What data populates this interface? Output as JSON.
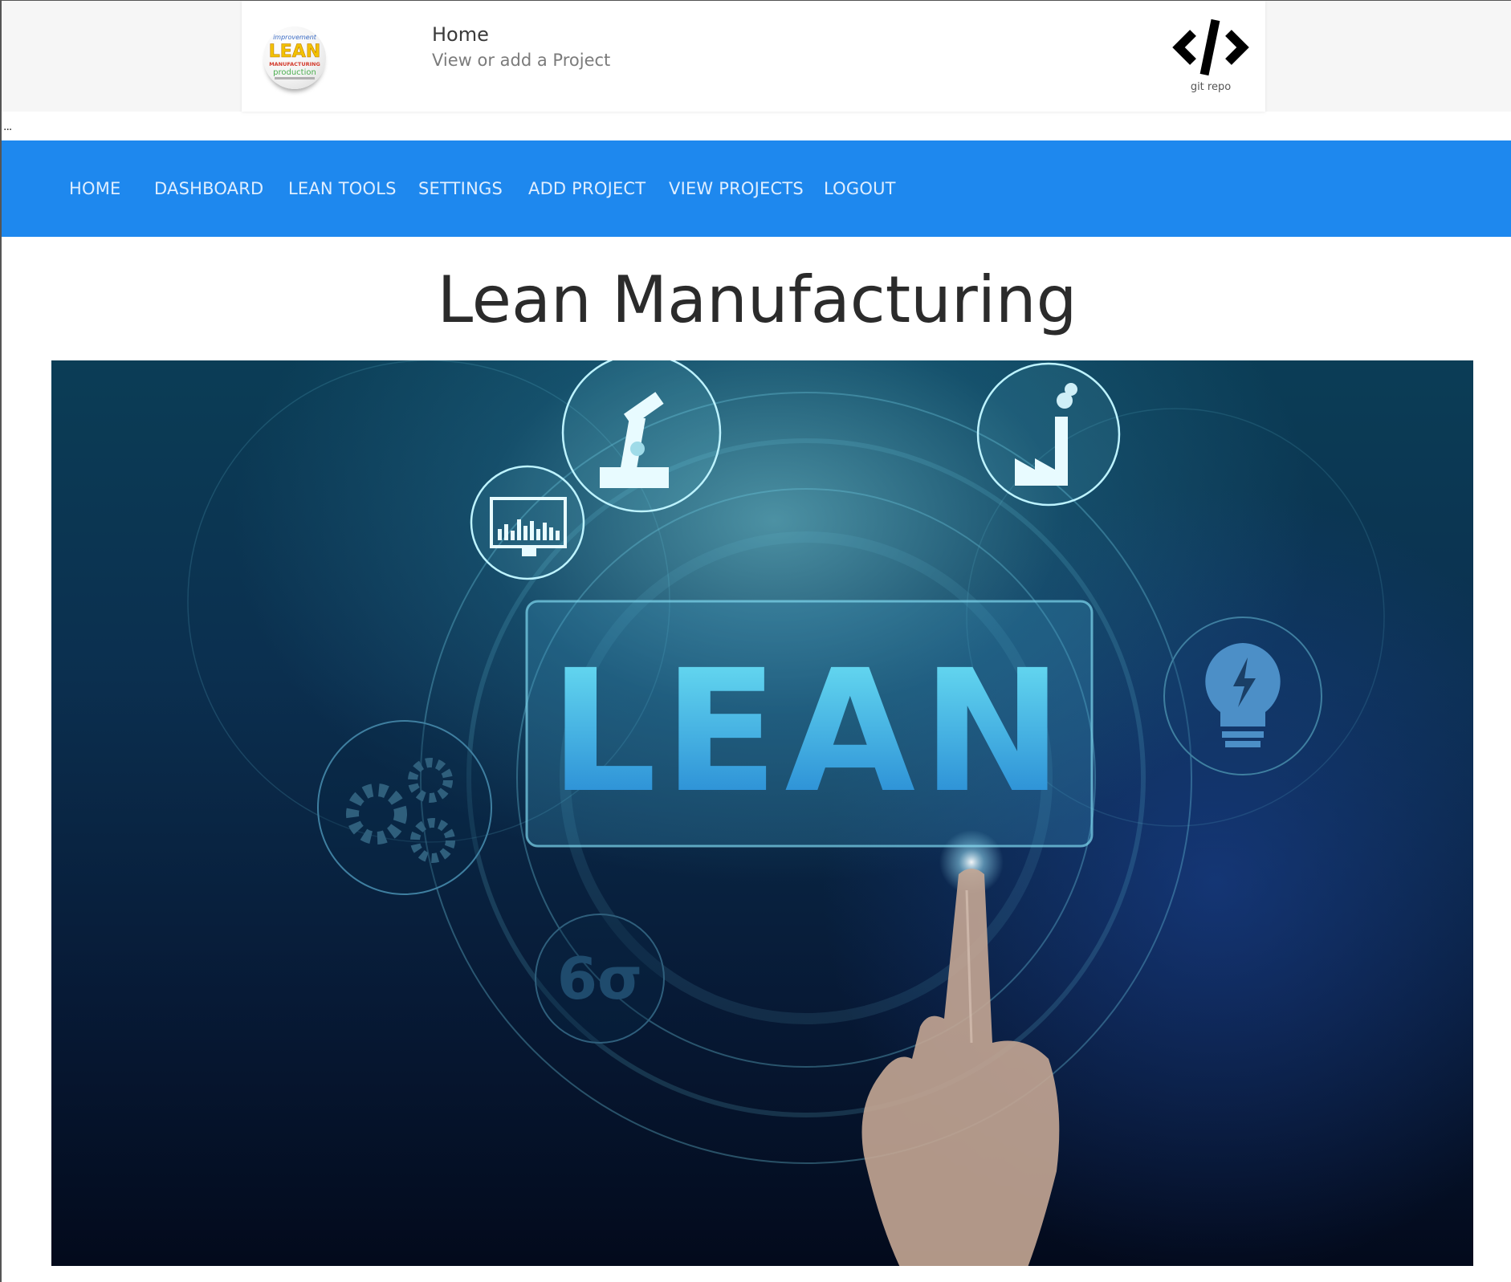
{
  "header": {
    "title": "Home",
    "subtitle": "View or add a Project",
    "git_label": "git repo",
    "logo_words": [
      "improvement",
      "LEAN",
      "MANUFACTURING",
      "production"
    ]
  },
  "ellipsis": "...",
  "nav": {
    "items": [
      {
        "label": "HOME"
      },
      {
        "label": "DASHBOARD"
      },
      {
        "label": "LEAN TOOLS"
      },
      {
        "label": "SETTINGS"
      },
      {
        "label": "ADD PROJECT"
      },
      {
        "label": "VIEW PROJECTS"
      },
      {
        "label": "LOGOUT"
      }
    ]
  },
  "main": {
    "title": "Lean Manufacturing",
    "hero": {
      "headline": "LEAN",
      "six_sigma": "6σ"
    }
  },
  "colors": {
    "nav_background": "#1e88ee",
    "nav_text": "#dfeeff",
    "title_text": "#2b2b2b"
  },
  "icons": [
    "lean-logo-icon",
    "code-icon",
    "robot-arm-icon",
    "factory-icon",
    "monitor-chart-icon",
    "gears-icon",
    "lightbulb-icon",
    "six-sigma-icon"
  ]
}
